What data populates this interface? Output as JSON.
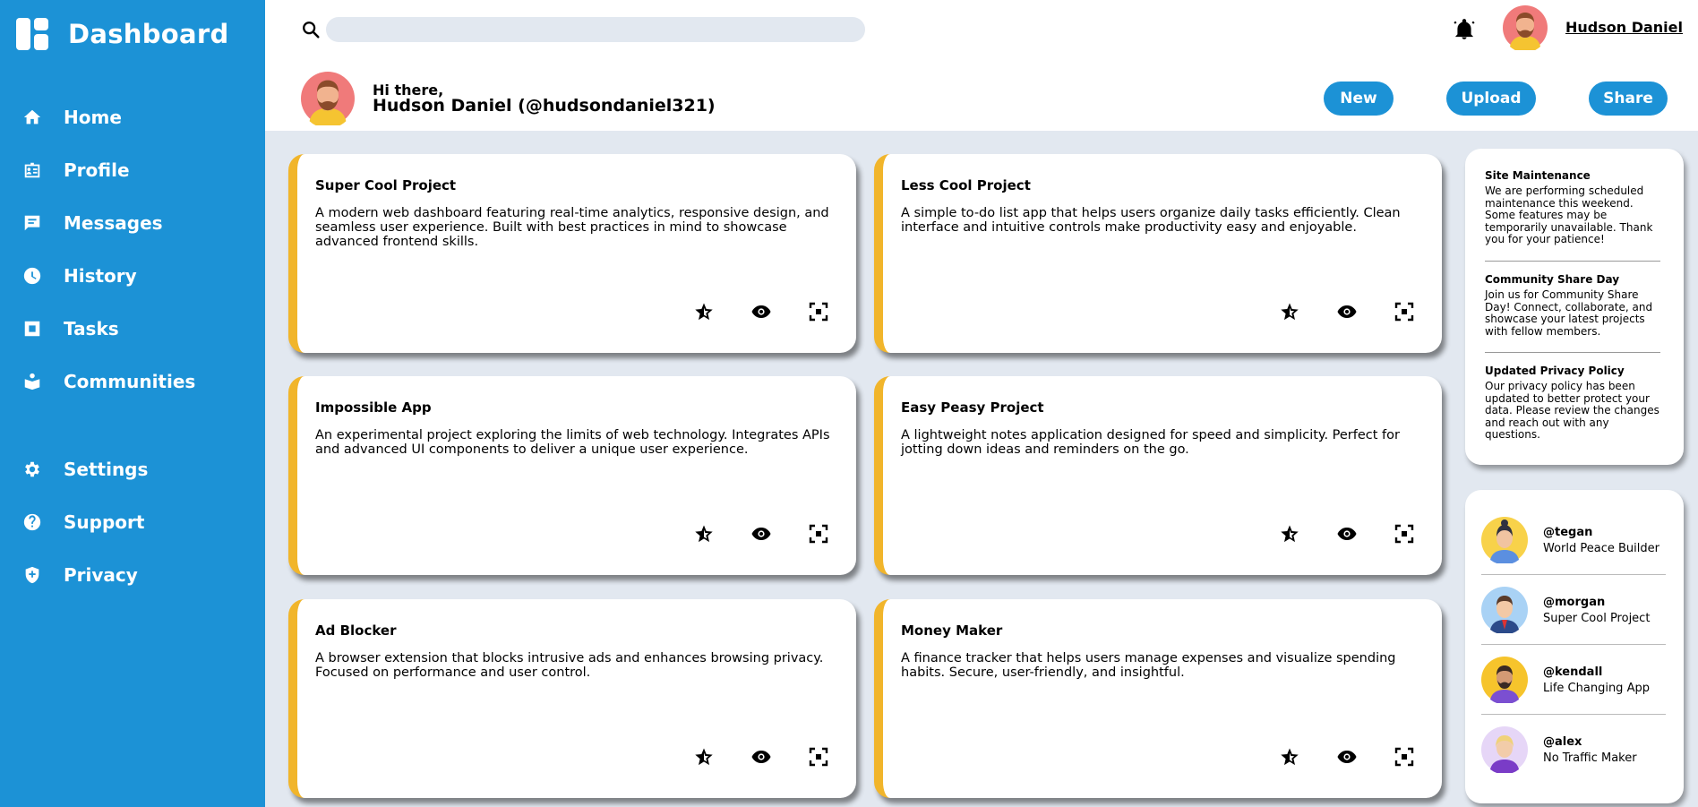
{
  "app": {
    "title": "Dashboard"
  },
  "sidebar": {
    "items": [
      {
        "label": "Home",
        "icon": "home-icon"
      },
      {
        "label": "Profile",
        "icon": "profile-icon"
      },
      {
        "label": "Messages",
        "icon": "messages-icon"
      },
      {
        "label": "History",
        "icon": "history-icon"
      },
      {
        "label": "Tasks",
        "icon": "tasks-icon"
      },
      {
        "label": "Communities",
        "icon": "communities-icon"
      },
      {
        "label": "Settings",
        "icon": "gear-icon"
      },
      {
        "label": "Support",
        "icon": "help-icon"
      },
      {
        "label": "Privacy",
        "icon": "shield-icon"
      }
    ]
  },
  "header": {
    "search_placeholder": "",
    "user_name": "Hudson Daniel",
    "greeting": "Hi there,",
    "greeting_name": "Hudson Daniel (@hudsondaniel321)",
    "buttons": {
      "new": "New",
      "upload": "Upload",
      "share": "Share"
    }
  },
  "projects": [
    {
      "title": "Super Cool Project",
      "description": "A modern web dashboard featuring real-time analytics, responsive design, and seamless user experience. Built with best practices in mind to showcase advanced frontend skills."
    },
    {
      "title": "Less Cool Project",
      "description": "A simple to-do list app that helps users organize daily tasks efficiently. Clean interface and intuitive controls make productivity easy and enjoyable."
    },
    {
      "title": "Impossible App",
      "description": "An experimental project exploring the limits of web technology. Integrates APIs and advanced UI components to deliver a unique user experience."
    },
    {
      "title": "Easy Peasy Project",
      "description": "A lightweight notes application designed for speed and simplicity. Perfect for jotting down ideas and reminders on the go."
    },
    {
      "title": "Ad Blocker",
      "description": "A browser extension that blocks intrusive ads and enhances browsing privacy. Focused on performance and user control."
    },
    {
      "title": "Money Maker",
      "description": "A finance tracker that helps users manage expenses and visualize spending habits. Secure, user-friendly, and insightful."
    }
  ],
  "announcements": [
    {
      "title": "Site Maintenance",
      "body": "We are performing scheduled maintenance this weekend. Some features may be temporarily unavailable. Thank you for your patience!"
    },
    {
      "title": "Community Share Day",
      "body": "Join us for Community Share Day! Connect, collaborate, and showcase your latest projects with fellow members."
    },
    {
      "title": "Updated Privacy Policy",
      "body": "Our privacy policy has been updated to better protect your data. Please review the changes and reach out with any questions."
    }
  ],
  "trending": [
    {
      "handle": "@tegan",
      "project": "World Peace Builder"
    },
    {
      "handle": "@morgan",
      "project": "Super Cool Project"
    },
    {
      "handle": "@kendall",
      "project": "Life Changing App"
    },
    {
      "handle": "@alex",
      "project": "No Traffic Maker"
    }
  ],
  "colors": {
    "primary": "#1c92d6",
    "accent": "#f1b52b",
    "background": "#e2e8f0",
    "card": "#ffffff"
  }
}
